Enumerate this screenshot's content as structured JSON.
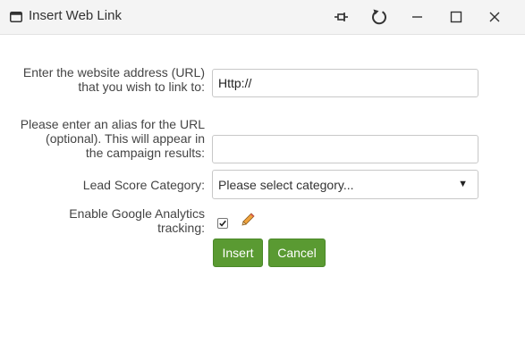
{
  "window": {
    "title": "Insert Web Link",
    "icons": [
      "window-icon",
      "pin-icon",
      "refresh-icon",
      "minimize-icon",
      "maximize-icon",
      "close-icon"
    ]
  },
  "form": {
    "url_label_line1": "Enter the website address (URL)",
    "url_label_line2": "that you wish to link to:",
    "url_value": "Http://",
    "alias_label_line1": "Please enter an alias for the URL",
    "alias_label_line2": "(optional). This will appear in",
    "alias_label_line3": "the campaign results:",
    "alias_value": "",
    "category_label": "Lead Score Category:",
    "category_selected": "Please select category...",
    "analytics_label_line1": "Enable Google Analytics",
    "analytics_label_line2": "tracking:",
    "analytics_checked": true
  },
  "buttons": {
    "insert": "Insert",
    "cancel": "Cancel"
  },
  "colors": {
    "button_green": "#5a9a32",
    "titlebar_bg": "#f4f4f4"
  }
}
